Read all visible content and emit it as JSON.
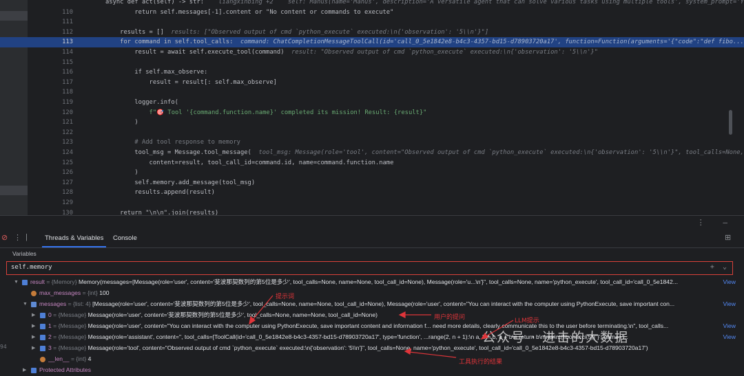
{
  "editor": {
    "lines": [
      {
        "n": "",
        "code": "async def act(self) -> str:  ",
        "hint": "  liangxinbing +2    self: Manus(name='Manus', description='A versatile agent that can solve various tasks using multiple tools', system_prompt='Yo"
      },
      {
        "n": "110",
        "code": "        return self.messages[-1].content or \"No content or commands to execute\"",
        "hint": ""
      },
      {
        "n": "111",
        "code": "",
        "hint": ""
      },
      {
        "n": "112",
        "code": "    results = []  ",
        "hint": "results: [\"Observed output of cmd `python_execute` executed:\\n{'observation': '5\\\\n'}\"]"
      },
      {
        "n": "113",
        "code": "    for command in self.tool_calls:  ",
        "hint": "command: ChatCompletionMessageToolCall(id='call_0_5e1842e8-b4c3-4357-bd15-d78903720a17', function=Function(arguments='{\"code\":\"def fibo..."
      },
      {
        "n": "114",
        "code": "        result = await self.execute_tool(command)  ",
        "hint": "result: \"Observed output of cmd `python_execute` executed:\\n{'observation': '5\\\\n'}\""
      },
      {
        "n": "115",
        "code": "",
        "hint": ""
      },
      {
        "n": "116",
        "code": "        if self.max_observe:",
        "hint": ""
      },
      {
        "n": "117",
        "code": "            result = result[: self.max_observe]",
        "hint": ""
      },
      {
        "n": "118",
        "code": "",
        "hint": ""
      },
      {
        "n": "119",
        "code": "        logger.info(",
        "hint": ""
      },
      {
        "n": "120",
        "code": "            f\"🎯 Tool '{command.function.name}' completed its mission! Result: {result}\"",
        "hint": ""
      },
      {
        "n": "121",
        "code": "        )",
        "hint": ""
      },
      {
        "n": "122",
        "code": "",
        "hint": ""
      },
      {
        "n": "123",
        "code": "        # Add tool response to memory",
        "hint": ""
      },
      {
        "n": "124",
        "code": "        tool_msg = Message.tool_message(  ",
        "hint": "tool_msg: Message(role='tool', content=\"Observed output of cmd `python_execute` executed:\\n{'observation': '5\\\\n'}\", tool_calls=None,"
      },
      {
        "n": "125",
        "code": "            content=result, tool_call_id=command.id, name=command.function.name",
        "hint": ""
      },
      {
        "n": "126",
        "code": "        )",
        "hint": ""
      },
      {
        "n": "127",
        "code": "        self.memory.add_message(tool_msg)",
        "hint": ""
      },
      {
        "n": "128",
        "code": "        results.append(result)",
        "hint": ""
      },
      {
        "n": "129",
        "code": "",
        "hint": ""
      },
      {
        "n": "130",
        "code": "    return \"\\n\\n\".join(results)",
        "hint": ""
      }
    ],
    "current_line": "113"
  },
  "panel": {
    "tabs": [
      "Threads & Variables",
      "Console"
    ],
    "variables_label": "Variables",
    "eval_expression": "self.memory",
    "tree": [
      {
        "indent": 0,
        "open": true,
        "name": "result",
        "type": "= {Memory}",
        "value": "Memory(messages=[Message(role='user', content='斐波那契数列的第5位是多少', tool_calls=None, name=None, tool_call_id=None), Message(role='u...\\n'}\", tool_calls=None, name='python_execute', tool_call_id='call_0_5e1842...",
        "view": "View"
      },
      {
        "indent": 1,
        "open": null,
        "name": "max_messages",
        "type": "= {int}",
        "value": "100",
        "view": ""
      },
      {
        "indent": 1,
        "open": true,
        "name": "messages",
        "type": "= {list: 4}",
        "value": "[Message(role='user', content='斐波那契数列的第5位是多少', tool_calls=None, name=None, tool_call_id=None), Message(role='user', content=\"You can interact with the computer using PythonExecute, save important con...",
        "view": "View"
      },
      {
        "indent": 2,
        "open": false,
        "name": "0",
        "type": "= {Message}",
        "value": "Message(role='user', content='斐波那契数列的第5位是多少', tool_calls=None, name=None, tool_call_id=None)",
        "view": ""
      },
      {
        "indent": 2,
        "open": false,
        "name": "1",
        "type": "= {Message}",
        "value": "Message(role='user', content=\"You can interact with the computer using PythonExecute, save important content and information f... need more details, clearly communicate this to the user before terminating.\\n\", tool_calls...",
        "view": "View"
      },
      {
        "indent": 2,
        "open": false,
        "name": "2",
        "type": "= {Message}",
        "value": "Message(role='assistant', content='', tool_calls=[ToolCall(id='call_0_5e1842e8-b4c3-4357-bd15-d78903720a17', type='function', ...range(2, n + 1):\\n        a, b = b, a + b\\n    return b\\n\\nprint(fibonacci(5))\"}', name='...",
        "view": "View"
      },
      {
        "indent": 2,
        "open": false,
        "name": "3",
        "type": "= {Message}",
        "value": "Message(role='tool', content=\"Observed output of cmd `python_execute` executed:\\n{'observation': '5\\\\n'}\", tool_calls=None, name='python_execute', tool_call_id='call_0_5e1842e8-b4c3-4357-bd15-d78903720a17')",
        "view": ""
      },
      {
        "indent": 2,
        "open": null,
        "name": "__len__",
        "type": "= {int}",
        "value": "4",
        "view": ""
      },
      {
        "indent": 1,
        "open": false,
        "name": "Protected Attributes",
        "type": "",
        "value": "",
        "view": ""
      }
    ],
    "annotations": {
      "prompt": "提示词",
      "user_question": "用户的提问",
      "llm_reply": "LLM提示",
      "tool_result": "工具执行的结果"
    },
    "watermark": "公众号 · 进击的大数据",
    "side_text": "94"
  },
  "colors": {
    "accent": "#3574f0",
    "highlight": "#214283",
    "annotation": "#e0353a"
  }
}
